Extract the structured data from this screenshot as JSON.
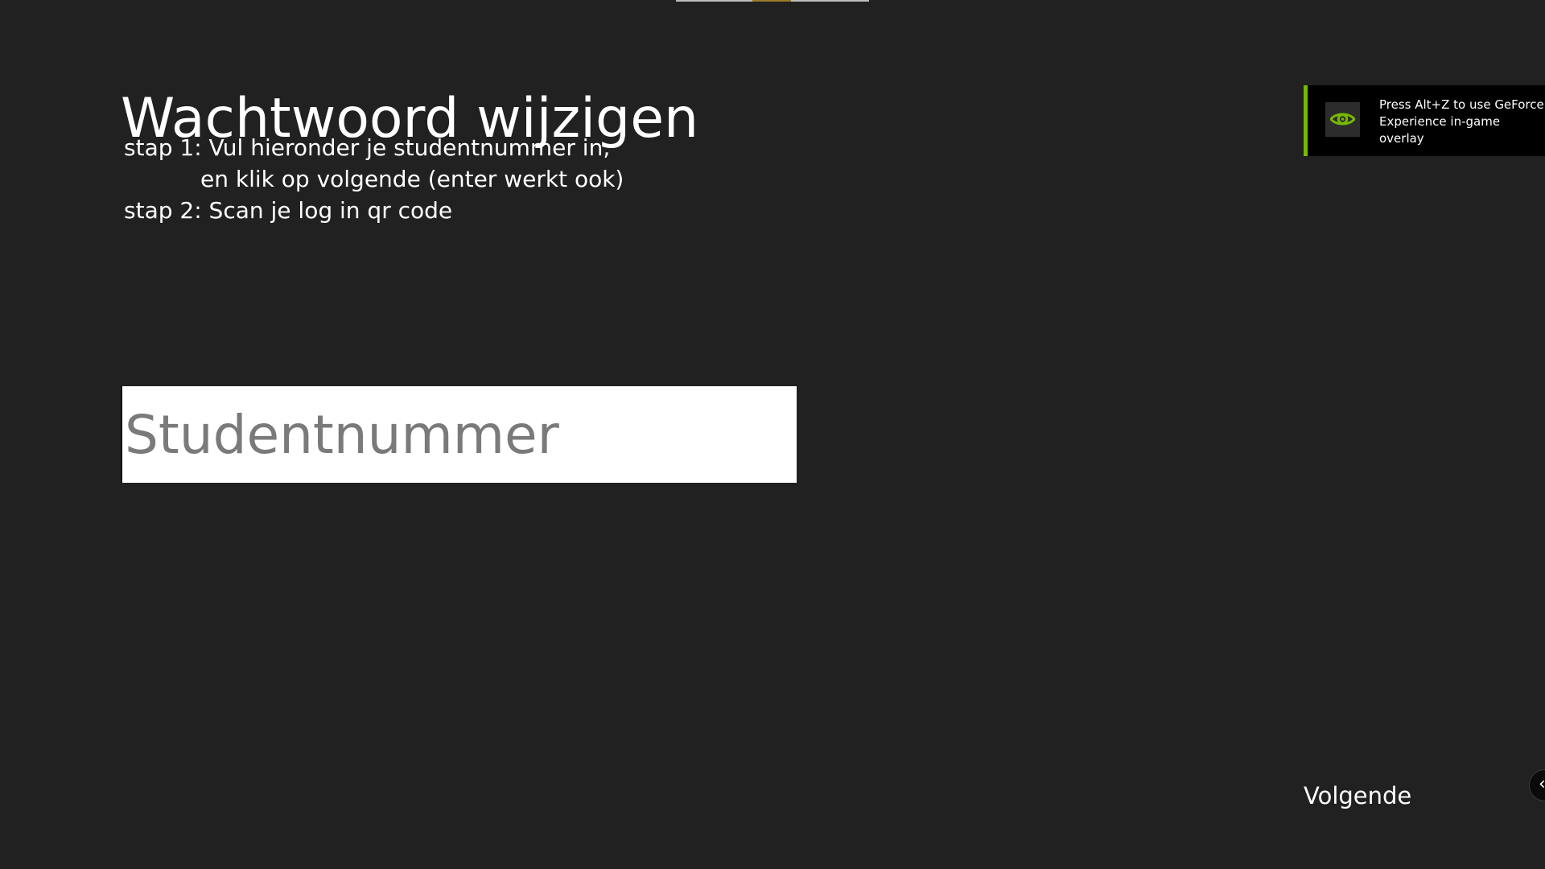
{
  "page": {
    "title": "Wachtwoord wijzigen",
    "instructions": [
      "stap 1: Vul hieronder je studentnummer in,",
      "en klik op volgende (enter werkt ook)",
      "stap 2: Scan je log in qr code"
    ]
  },
  "form": {
    "student_number": {
      "placeholder": "Studentnummer",
      "value": ""
    },
    "next_label": "Volgende"
  },
  "overlay_toast": {
    "icon": "nvidia-eye-icon",
    "message": "Press Alt+Z to use GeForce Experience in-game overlay",
    "accent_color": "#76b900"
  },
  "side_control": {
    "icon": "chevron-left-icon",
    "glyph": "‹"
  },
  "colors": {
    "background": "#212121",
    "text": "#ffffff",
    "input_background": "#ffffff",
    "placeholder": "#7a7a7a"
  }
}
